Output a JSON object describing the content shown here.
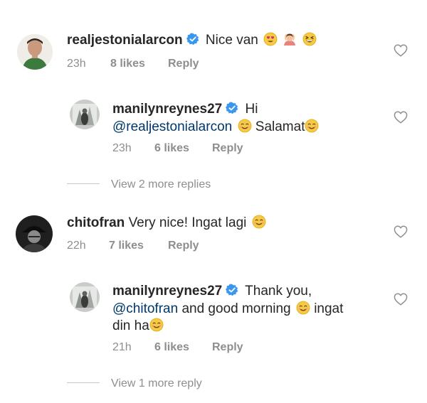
{
  "top_fragment": "",
  "comments": [
    {
      "username": "realjestonialarcon",
      "verified": true,
      "text_parts": [
        "Nice van"
      ],
      "time": "23h",
      "likes": "8 likes",
      "reply_label": "Reply",
      "emoji_names": [
        "smiling-face-with-heart-eyes",
        "person-gesturing-ok",
        "grinning-squinting-face"
      ]
    },
    {
      "username": "manilynreynes27",
      "verified": true,
      "text_parts": [
        "Hi",
        "@realjestonialarcon",
        "Salamat"
      ],
      "time": "23h",
      "likes": "6 likes",
      "reply_label": "Reply"
    },
    {
      "username": "chitofran",
      "verified": false,
      "text_parts": [
        "Very nice! Ingat lagi"
      ],
      "time": "22h",
      "likes": "7 likes",
      "reply_label": "Reply"
    },
    {
      "username": "manilynreynes27",
      "verified": true,
      "text_parts": [
        "Thank you,",
        "@chitofran",
        "and good morning",
        "ingat",
        "din ha"
      ],
      "time": "21h",
      "likes": "6 likes",
      "reply_label": "Reply"
    }
  ],
  "view_more": [
    "View 2 more replies",
    "View 1 more reply"
  ],
  "colors": {
    "verified_blue": "#3897f0",
    "mention_blue": "#00376b",
    "meta_gray": "#8e8e8e"
  }
}
